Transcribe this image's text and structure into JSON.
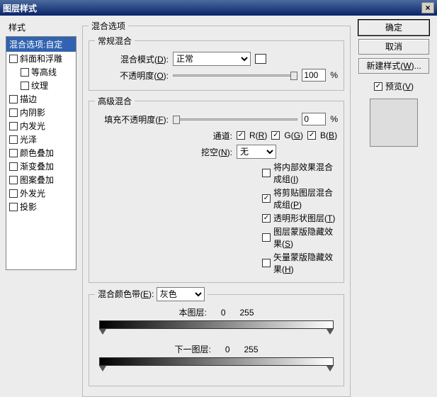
{
  "title": "图层样式",
  "left": {
    "heading": "样式",
    "selected": "混合选项:自定",
    "items": [
      {
        "label": "斜面和浮雕",
        "checked": false,
        "indent": false
      },
      {
        "label": "等高线",
        "checked": false,
        "indent": true
      },
      {
        "label": "纹理",
        "checked": false,
        "indent": true
      },
      {
        "label": "描边",
        "checked": false,
        "indent": false
      },
      {
        "label": "内阴影",
        "checked": false,
        "indent": false
      },
      {
        "label": "内发光",
        "checked": false,
        "indent": false
      },
      {
        "label": "光泽",
        "checked": false,
        "indent": false
      },
      {
        "label": "颜色叠加",
        "checked": false,
        "indent": false
      },
      {
        "label": "渐变叠加",
        "checked": false,
        "indent": false
      },
      {
        "label": "图案叠加",
        "checked": false,
        "indent": false
      },
      {
        "label": "外发光",
        "checked": false,
        "indent": false
      },
      {
        "label": "投影",
        "checked": false,
        "indent": false
      }
    ]
  },
  "center": {
    "group_label": "混合选项",
    "general": {
      "legend": "常规混合",
      "blend_mode_label": "混合模式",
      "blend_mode_key": "D",
      "blend_mode_value": "正常",
      "opacity_label": "不透明度",
      "opacity_key": "O",
      "opacity_value": "100",
      "pct": "%"
    },
    "advanced": {
      "legend": "高级混合",
      "fill_label": "填充不透明度",
      "fill_key": "F",
      "fill_value": "0",
      "pct": "%",
      "channels_label": "通道:",
      "ch_r": "R",
      "ch_rkey": "R",
      "ch_g": "G",
      "ch_gkey": "G",
      "ch_b": "B",
      "ch_bkey": "B",
      "knockout_label": "挖空",
      "knockout_key": "N",
      "knockout_value": "无",
      "opts": [
        {
          "label": "将内部效果混合成组",
          "key": "I",
          "checked": false
        },
        {
          "label": "将剪贴图层混合成组",
          "key": "P",
          "checked": true
        },
        {
          "label": "透明形状图层",
          "key": "T",
          "checked": true
        },
        {
          "label": "图层蒙版隐藏效果",
          "key": "S",
          "checked": false
        },
        {
          "label": "矢量蒙版隐藏效果",
          "key": "H",
          "checked": false
        }
      ]
    },
    "band": {
      "legend_label": "混合颜色带",
      "legend_key": "E",
      "channel": "灰色",
      "this_label": "本图层:",
      "this_lo": "0",
      "this_hi": "255",
      "next_label": "下一图层:",
      "next_lo": "0",
      "next_hi": "255"
    }
  },
  "right": {
    "ok": "确定",
    "cancel": "取消",
    "newstyle": "新建样式",
    "newstyle_key": "W",
    "preview": "预览",
    "preview_key": "V"
  }
}
